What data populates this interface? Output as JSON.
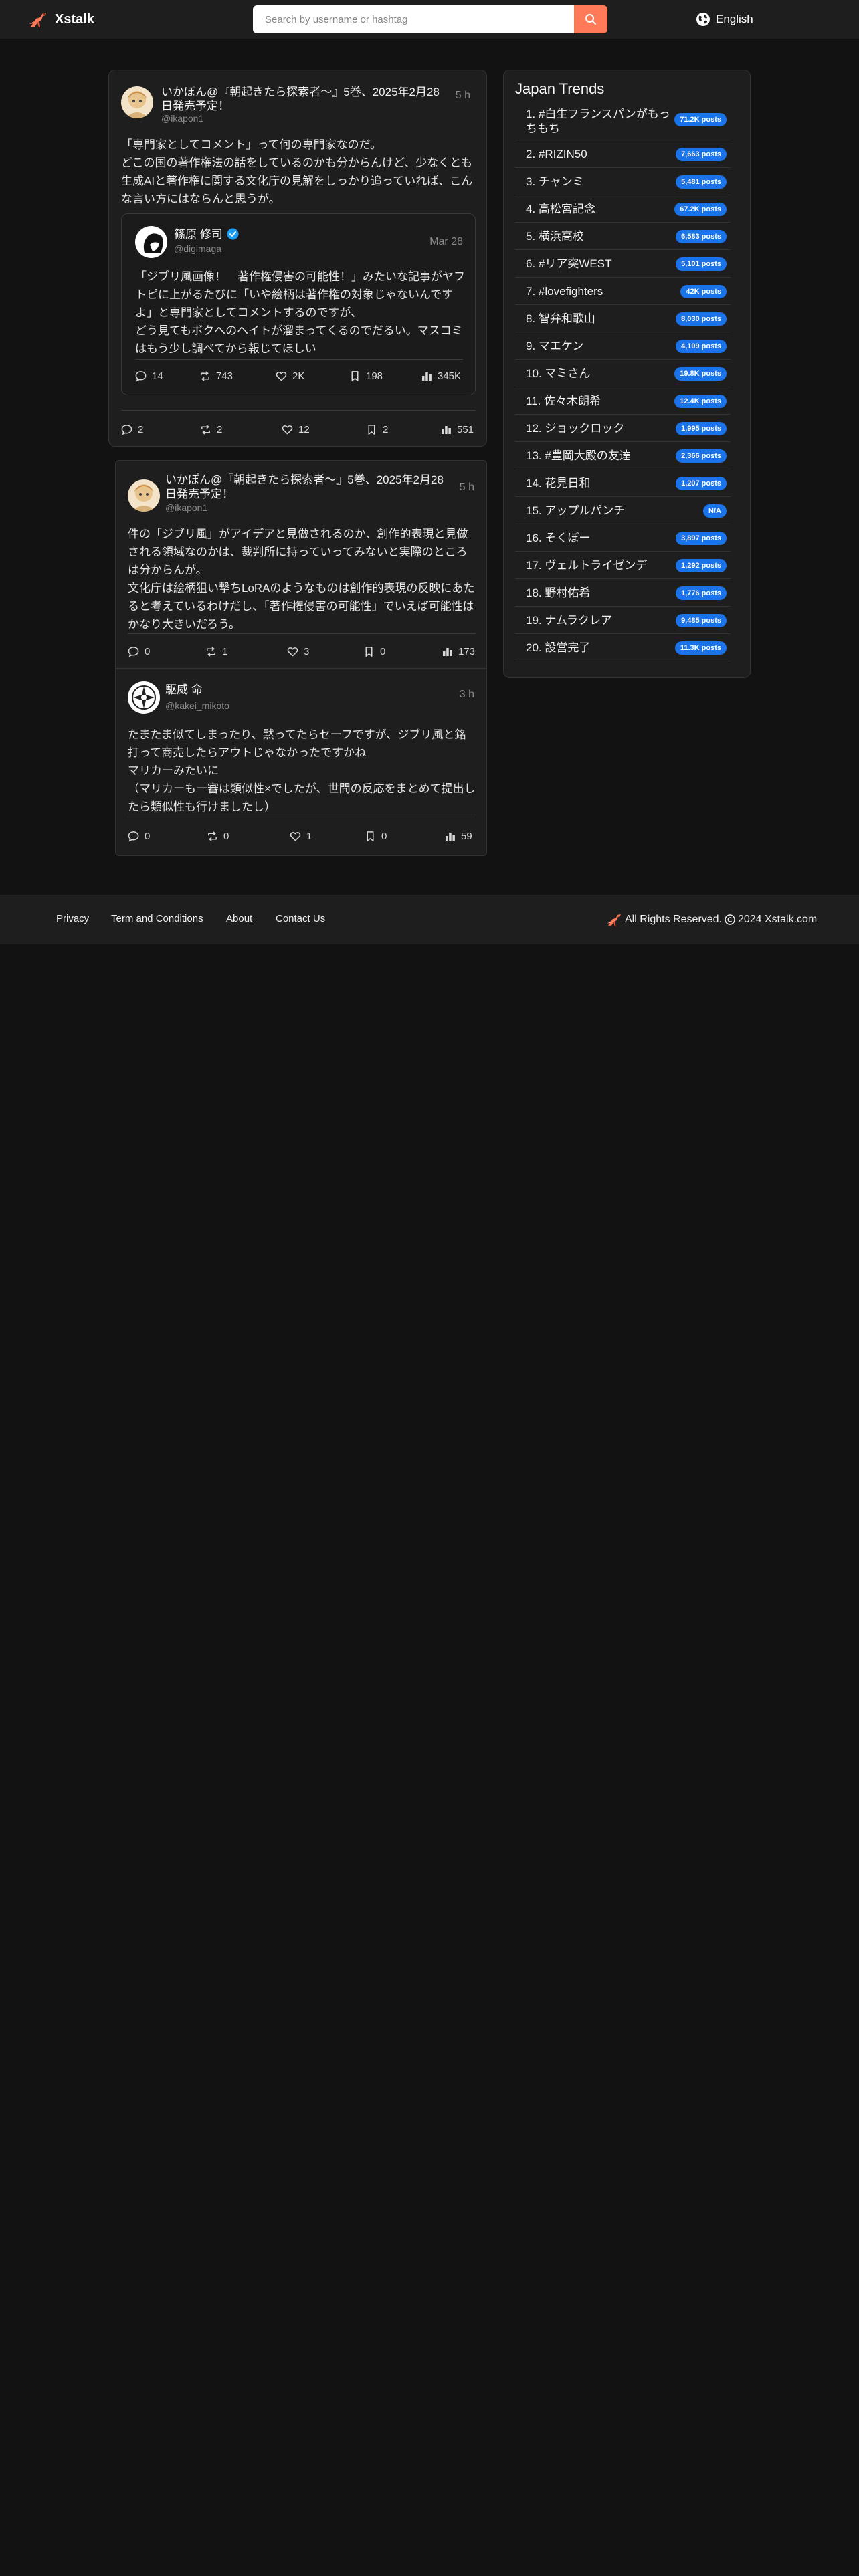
{
  "app": {
    "name": "Xstalk"
  },
  "search": {
    "placeholder": "Search by username or hashtag"
  },
  "language": {
    "label": "English"
  },
  "posts": [
    {
      "author": "いかぽん@『朝起きたら探索者〜』5巻、2025年2月28日発売予定！",
      "handle": "@ikapon1",
      "time": "5 h",
      "text": "「専門家としてコメント」って何の専門家なのだ。\nどこの国の著作権法の話をしているのかも分からんけど、少なくとも生成AIと著作権に関する文化庁の見解をしっかり追っていれば、こんな言い方にはならんと思うが。",
      "quote": {
        "author": "篠原 修司",
        "handle": "@digimaga",
        "time": "Mar 28",
        "text": "「ジブリ風画像！　著作権侵害の可能性！」みたいな記事がヤフトピに上がるたびに「いや絵柄は著作権の対象じゃないんですよ」と専門家としてコメントするのですが、\nどう見てもボクへのヘイトが溜まってくるのでだるい。マスコミはもう少し調べてから報じてほしい",
        "stats": {
          "replies": "14",
          "reposts": "743",
          "likes": "2K",
          "bookmarks": "198",
          "views": "345K"
        }
      },
      "stats": {
        "replies": "2",
        "reposts": "2",
        "likes": "12",
        "bookmarks": "2",
        "views": "551"
      }
    },
    {
      "author": "いかぽん@『朝起きたら探索者〜』5巻、2025年2月28日発売予定！",
      "handle": "@ikapon1",
      "time": "5 h",
      "text": "件の「ジブリ風」がアイデアと見做されるのか、創作的表現と見做される領域なのかは、裁判所に持っていってみないと実際のところは分からんが。\n文化庁は絵柄狙い撃ちLoRAのようなものは創作的表現の反映にあたると考えているわけだし、「著作権侵害の可能性」でいえば可能性はかなり大きいだろう。",
      "stats": {
        "replies": "0",
        "reposts": "1",
        "likes": "3",
        "bookmarks": "0",
        "views": "173"
      }
    },
    {
      "author": "駆威 命",
      "handle": "@kakei_mikoto",
      "time": "3 h",
      "text": "たまたま似てしまったり、黙ってたらセーフですが、ジブリ風と銘打って商売したらアウトじゃなかったですかね\nマリカーみたいに\n（マリカーも一審は類似性×でしたが、世間の反応をまとめて提出したら類似性も行けましたし）",
      "stats": {
        "replies": "0",
        "reposts": "0",
        "likes": "1",
        "bookmarks": "0",
        "views": "59"
      }
    }
  ],
  "trends": {
    "title": "Japan Trends",
    "items": [
      {
        "label": "1. #白生フランスパンがもっちもち",
        "count": "71.2K posts"
      },
      {
        "label": "2. #RIZIN50",
        "count": "7,663 posts"
      },
      {
        "label": "3. チャンミ",
        "count": "5,481 posts"
      },
      {
        "label": "4. 高松宮記念",
        "count": "67.2K posts"
      },
      {
        "label": "5. 横浜高校",
        "count": "6,583 posts"
      },
      {
        "label": "6. #リア突WEST",
        "count": "5,101 posts"
      },
      {
        "label": "7. #lovefighters",
        "count": "42K posts"
      },
      {
        "label": "8. 智弁和歌山",
        "count": "8,030 posts"
      },
      {
        "label": "9. マエケン",
        "count": "4,109 posts"
      },
      {
        "label": "10. マミさん",
        "count": "19.8K posts"
      },
      {
        "label": "11. 佐々木朗希",
        "count": "12.4K posts"
      },
      {
        "label": "12. ジョックロック",
        "count": "1,995 posts"
      },
      {
        "label": "13. #豊岡大殿の友達",
        "count": "2,366 posts"
      },
      {
        "label": "14. 花見日和",
        "count": "1,207 posts"
      },
      {
        "label": "15. アップルパンチ",
        "count": "N/A"
      },
      {
        "label": "16. そくぼー",
        "count": "3,897 posts"
      },
      {
        "label": "17. ヴェルトライゼンデ",
        "count": "1,292 posts"
      },
      {
        "label": "18. 野村佑希",
        "count": "1,776 posts"
      },
      {
        "label": "19. ナムラクレア",
        "count": "9,485 posts"
      },
      {
        "label": "20. 設営完了",
        "count": "11.3K posts"
      }
    ]
  },
  "footer": {
    "links": [
      "Privacy",
      "Term and Conditions",
      "About",
      "Contact Us"
    ],
    "rights": "All Rights Reserved.",
    "copyright": "2024 Xstalk.com"
  },
  "colors": {
    "accent": "#ff7a59",
    "badge": "#1a73e8",
    "background": "#121212",
    "card": "#1e1e1e"
  }
}
